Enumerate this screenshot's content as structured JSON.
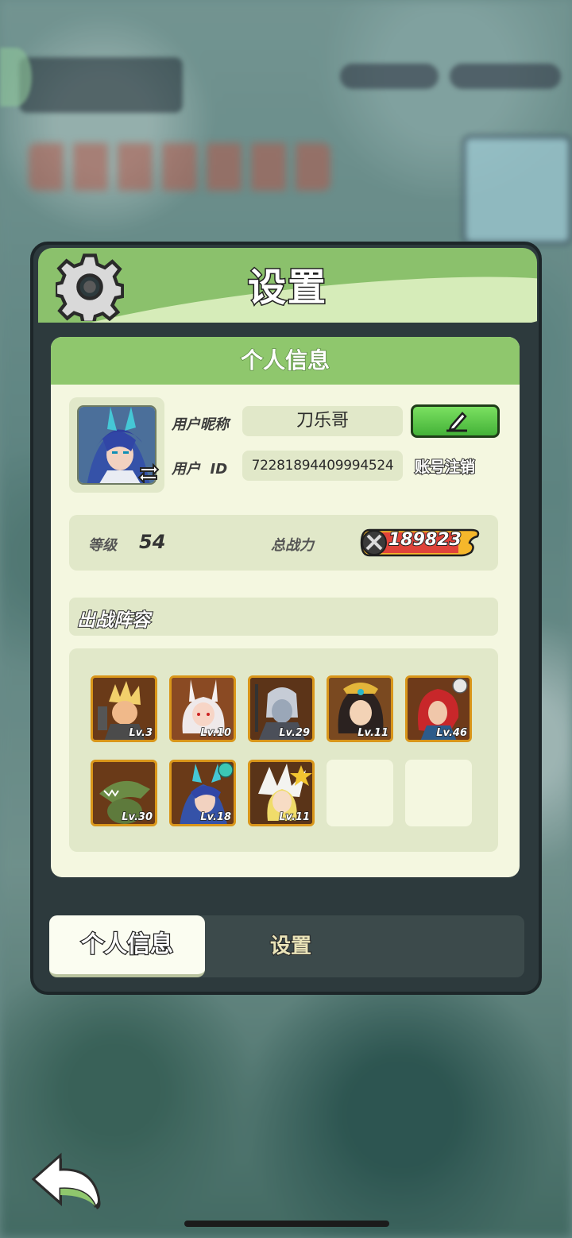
{
  "window": {
    "title": "设置"
  },
  "card": {
    "header": "个人信息"
  },
  "profile": {
    "nickname_label": "用户昵称",
    "nickname": "刀乐哥",
    "id_label": "用户  ID",
    "user_id": "72281894409994524",
    "logout_label": "账号注销",
    "edit_icon": "pencil-icon",
    "swap_icon": "swap-arrows-icon"
  },
  "stats": {
    "level_label": "等级",
    "level": "54",
    "power_label": "总战力",
    "power": "189823"
  },
  "lineup": {
    "title": "出战阵容",
    "heroes": [
      {
        "lv": "Lv.3"
      },
      {
        "lv": "Lv.10"
      },
      {
        "lv": "Lv.29"
      },
      {
        "lv": "Lv.11"
      },
      {
        "lv": "Lv.46"
      },
      {
        "lv": "Lv.30"
      },
      {
        "lv": "Lv.18"
      },
      {
        "lv": "Lv.11"
      }
    ]
  },
  "tabs": {
    "active": "个人信息",
    "inactive": "设置"
  },
  "colors": {
    "accent_green": "#8bc16c",
    "card_bg": "#f4f7e0",
    "hero_border": "#d9961a",
    "edit_button": "#4bbd3b"
  }
}
